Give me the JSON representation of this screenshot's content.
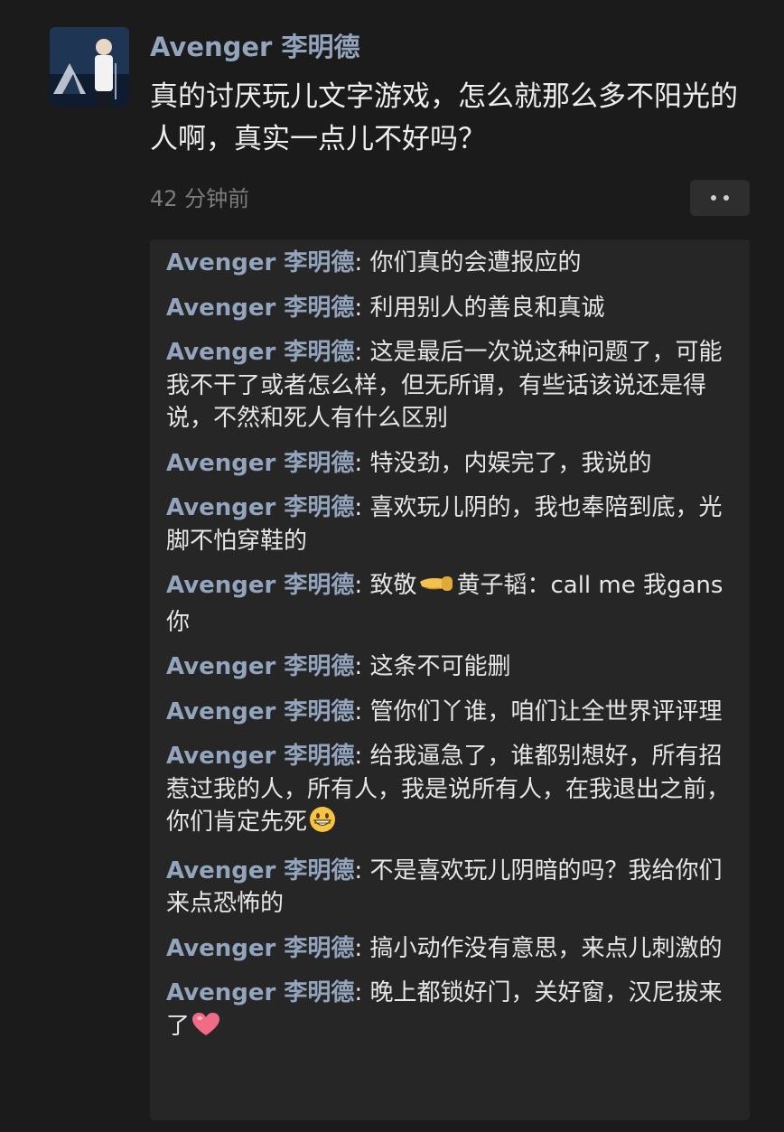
{
  "post": {
    "author": "Avenger 李明德",
    "text": "真的讨厌玩儿文字游戏，怎么就那么多不阳光的人啊，真实一点儿不好吗？",
    "timestamp": "42 分钟前"
  },
  "comments": [
    {
      "author": "Avenger 李明德",
      "sep": ": ",
      "text": "你们真的会遭报应的"
    },
    {
      "author": "Avenger 李明德",
      "sep": ": ",
      "text": "利用别人的善良和真诚"
    },
    {
      "author": "Avenger 李明德",
      "sep": ": ",
      "text": "这是最后一次说这种问题了，可能我不干了或者怎么样，但无所谓，有些话该说还是得说，不然和死人有什么区别"
    },
    {
      "author": "Avenger 李明德",
      "sep": ": ",
      "text": "特没劲，内娱完了，我说的"
    },
    {
      "author": "Avenger 李明德",
      "sep": ": ",
      "text": "喜欢玩儿阴的，我也奉陪到底，光脚不怕穿鞋的"
    },
    {
      "author": "Avenger 李明德",
      "sep": ": ",
      "text": "致敬",
      "emoji": "pointing-hand-emoji",
      "text_after": "黄子韬：call me  我gans你"
    },
    {
      "author": "Avenger 李明德",
      "sep": ": ",
      "text": "这条不可能删"
    },
    {
      "author": "Avenger 李明德",
      "sep": ": ",
      "text": "管你们丫谁，咱们让全世界评评理"
    },
    {
      "author": "Avenger 李明德",
      "sep": ": ",
      "text": "给我逼急了，谁都别想好，所有招惹过我的人，所有人，我是说所有人，在我退出之前，你们肯定先死",
      "emoji": "grinning-face-emoji",
      "text_after": ""
    },
    {
      "author": "Avenger 李明德",
      "sep": ": ",
      "text": "不是喜欢玩儿阴暗的吗？我给你们来点恐怖的"
    },
    {
      "author": "Avenger 李明德",
      "sep": ": ",
      "text": "搞小动作没有意思，来点儿刺激的"
    },
    {
      "author": "Avenger 李明德",
      "sep": ": ",
      "text": "晚上都锁好门，关好窗，汉尼拔来了",
      "emoji": "heart-emoji",
      "text_after": ""
    }
  ],
  "colors": {
    "background": "#1b1b1b",
    "comment_panel": "#262626",
    "username": "#93a4bd",
    "text": "#eeeeee",
    "muted": "#7c7c7c"
  }
}
